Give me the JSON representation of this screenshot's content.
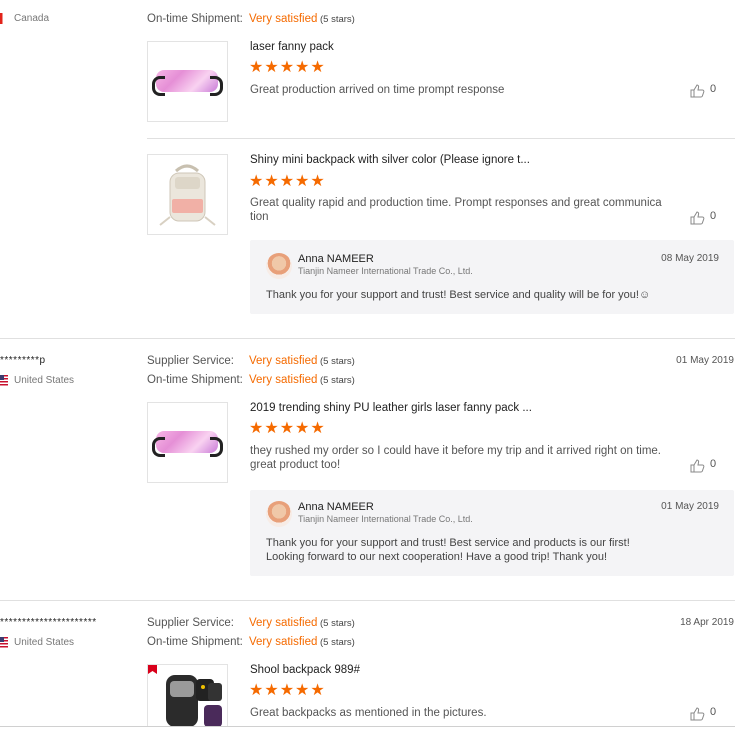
{
  "reviews": [
    {
      "country": "Canada",
      "ratings": [
        {
          "label": "On-time Shipment:",
          "value": "Very satisfied",
          "stars": "(5 stars)"
        }
      ],
      "items": [
        {
          "title": "laser fanny pack",
          "stars": "★★★★★",
          "text": "Great production arrived on time prompt response",
          "likes": "0"
        },
        {
          "title": "Shiny mini backpack with silver color (Please ignore t...",
          "stars": "★★★★★",
          "text_line1": "Great quality rapid and production time. Prompt responses and great communica",
          "text_line2": "tion",
          "likes": "0",
          "reply": {
            "name": "Anna NAMEER",
            "company": "Tianjin Nameer International Trade Co., Ltd.",
            "date": "08 May 2019",
            "text": "Thank you for your support and trust! Best service and quality will be for you!☺"
          }
        }
      ]
    },
    {
      "user": "*********p",
      "country": "United States",
      "date": "01 May 2019",
      "ratings": [
        {
          "label": "Supplier Service:",
          "value": "Very satisfied",
          "stars": "(5 stars)"
        },
        {
          "label": "On-time Shipment:",
          "value": "Very satisfied",
          "stars": "(5 stars)"
        }
      ],
      "items": [
        {
          "title": "2019 trending shiny PU leather girls laser fanny pack ...",
          "stars": "★★★★★",
          "text_line1": "they rushed my order so I could have it before my trip and it arrived right on time.",
          "text_line2": "great product too!",
          "likes": "0",
          "reply": {
            "name": "Anna NAMEER",
            "company": "Tianjin Nameer International Trade Co., Ltd.",
            "date": "01 May 2019",
            "text_line1": "Thank you for your support and trust! Best service and products is our first!",
            "text_line2": "Looking forward to our next cooperation! Have a good trip! Thank you!"
          }
        }
      ]
    },
    {
      "user": "**********************",
      "country": "United States",
      "date": "18 Apr 2019",
      "ratings": [
        {
          "label": "Supplier Service:",
          "value": "Very satisfied",
          "stars": "(5 stars)"
        },
        {
          "label": "On-time Shipment:",
          "value": "Very satisfied",
          "stars": "(5 stars)"
        }
      ],
      "items": [
        {
          "title": "Shool backpack 989#",
          "stars": "★★★★★",
          "text": "Great backpacks as mentioned in the pictures.",
          "likes": "0"
        }
      ]
    }
  ],
  "icons": {
    "like": "thumbs-up-icon",
    "star": "star-icon"
  },
  "colors": {
    "accent": "#f56a00",
    "reply_bg": "#f4f4f6",
    "divider": "#e0e0e0"
  }
}
